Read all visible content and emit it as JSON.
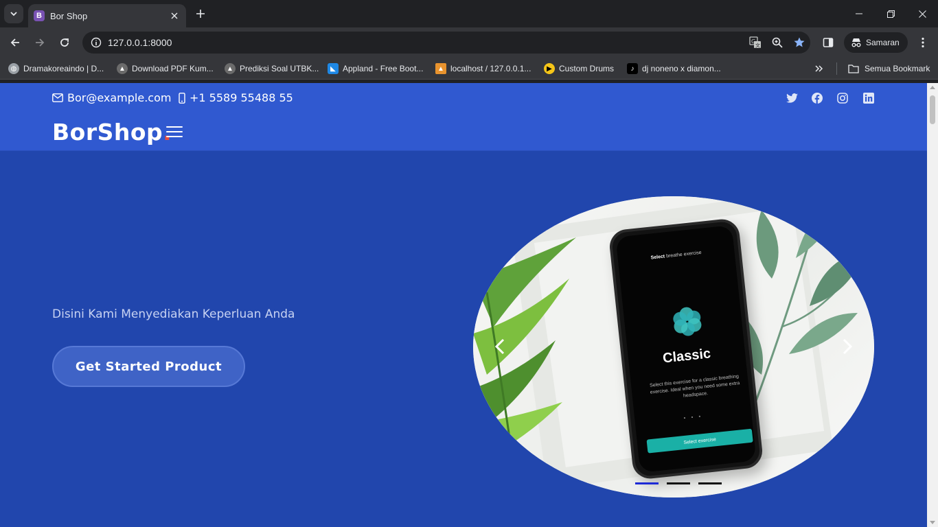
{
  "browser": {
    "tab_title": "Bor Shop",
    "tab_favicon_letter": "B",
    "url": "127.0.0.1:8000",
    "profile_label": "Samaran",
    "bookmarks": [
      {
        "label": "Dramakoreaindo | D...",
        "icon": "globe-icon"
      },
      {
        "label": "Download PDF Kum...",
        "icon": "hat-icon"
      },
      {
        "label": "Prediksi Soal UTBK...",
        "icon": "hat-icon"
      },
      {
        "label": "Appland - Free Boot...",
        "icon": "appland-icon"
      },
      {
        "label": "localhost / 127.0.0.1...",
        "icon": "phpmyadmin-icon"
      },
      {
        "label": "Custom Drums",
        "icon": "play-icon"
      },
      {
        "label": "dj noneno x diamon...",
        "icon": "tiktok-icon"
      }
    ],
    "all_bookmarks_label": "Semua Bookmark"
  },
  "topbar": {
    "email": "Bor@example.com",
    "phone": "+1 5589 55488 55",
    "socials": [
      "twitter-icon",
      "facebook-icon",
      "instagram-icon",
      "linkedin-icon"
    ]
  },
  "header": {
    "logo_text": "BorShop",
    "logo_dot": "."
  },
  "hero": {
    "subtitle": "Disini Kami Menyediakan Keperluan Anda",
    "cta_label": "Get Started Product"
  },
  "carousel": {
    "phone": {
      "top_bold": "Select",
      "top_rest": "breathe exercise",
      "title": "Classic",
      "description": "Select this exercise for a classic breathing exercise. Ideal when you need some extra headspace.",
      "button": "Select exercise"
    },
    "slide_count": 3,
    "active_index": 0
  },
  "colors": {
    "hero_bg": "#2146ad",
    "topbar_bg": "#3059d0",
    "logo_dot": "#e94c3d",
    "indicator_active": "#1d2ad6"
  }
}
